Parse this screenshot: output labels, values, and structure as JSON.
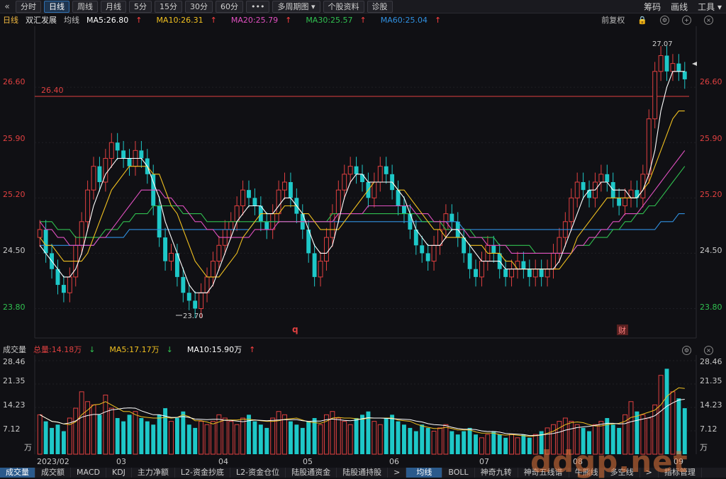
{
  "toolbar": {
    "back_icon": "chevron-left-icon",
    "tabs": [
      "分时",
      "日线",
      "周线",
      "月线",
      "5分",
      "15分",
      "30分",
      "60分",
      "•••",
      "多周期图",
      "个股资料",
      "诊股"
    ],
    "active_tab": "日线",
    "dropdown_label": "多周期图",
    "right_items": [
      "筹码",
      "画线",
      "工具"
    ]
  },
  "legend": {
    "period": "日线",
    "stock_name": "双汇发展",
    "ma_label": "均线",
    "ma5": "MA5:26.80",
    "ma10": "MA10:26.31",
    "ma20": "MA20:25.79",
    "ma30": "MA30:25.57",
    "ma60": "MA60:25.04",
    "adjust": "前复权",
    "colors": {
      "ma5": "#ffffff",
      "ma10": "#f0c020",
      "ma20": "#e050c0",
      "ma30": "#30c050",
      "ma60": "#3090e0"
    }
  },
  "price_axis": {
    "ticks": [
      "26.60",
      "25.90",
      "25.20",
      "24.50",
      "23.80"
    ],
    "ref_line": "26.40",
    "high_label": "27.07",
    "low_label": "23.70",
    "marker_q": "q",
    "marker_cai": "财"
  },
  "volume": {
    "title": "成交量",
    "total": "总量:14.18万",
    "ma5": "MA5:17.17万",
    "ma10": "MA10:15.90万",
    "ticks": [
      "28.46",
      "21.35",
      "14.23",
      "7.12",
      "万"
    ],
    "dates": [
      "2023/02",
      "03",
      "04",
      "05",
      "06",
      "07",
      "08",
      "09"
    ]
  },
  "bottom_tabs": [
    "成交量",
    "成交额",
    "MACD",
    "KDJ",
    "主力净额",
    "L2-资金抄底",
    "L2-资金仓位",
    "陆股通资金",
    "陆股通持股",
    "均线",
    "BOLL",
    "神奇九转",
    "神奇五线谱",
    "牛熊线",
    "多空线",
    "指标管理"
  ],
  "bottom_active": [
    "成交量",
    "均线"
  ],
  "watermark": "ddgp.net",
  "chart_data": {
    "type": "candlestick",
    "price_range": [
      23.5,
      27.3
    ],
    "volume_range": [
      0,
      28.46
    ],
    "volume_unit": "万",
    "closes": [
      24.8,
      24.5,
      24.3,
      24.1,
      24.0,
      24.2,
      24.6,
      24.9,
      25.3,
      25.6,
      25.4,
      25.7,
      25.9,
      25.8,
      25.7,
      25.6,
      25.8,
      25.7,
      25.5,
      25.1,
      24.7,
      24.4,
      24.5,
      24.2,
      24.0,
      23.9,
      23.8,
      24.0,
      24.2,
      24.4,
      24.6,
      24.8,
      24.9,
      25.1,
      25.3,
      25.2,
      25.1,
      24.9,
      24.8,
      25.0,
      25.3,
      25.4,
      25.2,
      25.0,
      24.8,
      24.5,
      24.2,
      24.4,
      24.7,
      25.0,
      25.3,
      25.5,
      25.6,
      25.5,
      25.4,
      25.2,
      25.4,
      25.6,
      25.5,
      25.3,
      25.1,
      25.0,
      24.8,
      24.6,
      24.5,
      24.4,
      24.6,
      24.8,
      25.0,
      24.9,
      24.7,
      24.5,
      24.3,
      24.2,
      24.4,
      24.6,
      24.5,
      24.3,
      24.2,
      24.3,
      24.4,
      24.3,
      24.2,
      24.3,
      24.2,
      24.3,
      24.5,
      24.7,
      24.9,
      25.2,
      25.4,
      25.3,
      25.2,
      25.4,
      25.5,
      25.4,
      25.2,
      25.1,
      25.2,
      25.3,
      25.2,
      25.5,
      26.2,
      26.8,
      27.0,
      26.8,
      26.9,
      26.8,
      26.7
    ],
    "volumes": [
      12,
      10,
      8,
      9,
      7,
      11,
      14,
      19,
      16,
      15,
      12,
      18,
      14,
      11,
      10,
      12,
      13,
      11,
      10,
      9,
      12,
      14,
      10,
      11,
      13,
      9,
      8,
      10,
      9,
      10,
      12,
      11,
      10,
      9,
      11,
      12,
      10,
      9,
      8,
      11,
      13,
      12,
      10,
      9,
      8,
      10,
      11,
      9,
      12,
      13,
      11,
      10,
      9,
      11,
      12,
      13,
      10,
      9,
      11,
      12,
      10,
      9,
      8,
      7,
      9,
      8,
      7,
      8,
      9,
      7,
      6,
      7,
      8,
      6,
      5,
      6,
      7,
      6,
      5,
      6,
      5,
      6,
      5,
      6,
      7,
      8,
      9,
      10,
      11,
      10,
      9,
      8,
      7,
      9,
      10,
      11,
      9,
      8,
      12,
      16,
      13,
      12,
      11,
      15,
      24,
      26,
      19,
      17,
      14
    ],
    "ma5": [
      24.6,
      24.5,
      24.4,
      24.3,
      24.2,
      24.2,
      24.3,
      24.5,
      24.8,
      25.1,
      25.3,
      25.5,
      25.6,
      25.7,
      25.7,
      25.7,
      25.7,
      25.7,
      25.6,
      25.4,
      25.2,
      24.9,
      24.7,
      24.5,
      24.3,
      24.1,
      24.0,
      24.0,
      24.0,
      24.1,
      24.3,
      24.5,
      24.7,
      24.9,
      25.0,
      25.1,
      25.1,
      25.1,
      25.0,
      25.0,
      25.1,
      25.2,
      25.2,
      25.1,
      25.0,
      24.8,
      24.6,
      24.5,
      24.5,
      24.6,
      24.9,
      25.2,
      25.4,
      25.5,
      25.5,
      25.4,
      25.4,
      25.4,
      25.4,
      25.4,
      25.3,
      25.2,
      25.0,
      24.8,
      24.7,
      24.6,
      24.6,
      24.6,
      24.7,
      24.8,
      24.8,
      24.7,
      24.6,
      24.5,
      24.4,
      24.4,
      24.4,
      24.4,
      24.3,
      24.3,
      24.3,
      24.3,
      24.3,
      24.3,
      24.3,
      24.3,
      24.3,
      24.4,
      24.6,
      24.8,
      25.0,
      25.2,
      25.3,
      25.3,
      25.4,
      25.4,
      25.3,
      25.3,
      25.3,
      25.2,
      25.2,
      25.3,
      25.5,
      25.8,
      26.3,
      26.6,
      26.8,
      26.8,
      26.8
    ],
    "ma10": [
      24.7,
      24.6,
      24.6,
      24.5,
      24.4,
      24.4,
      24.4,
      24.4,
      24.5,
      24.7,
      24.9,
      25.1,
      25.3,
      25.4,
      25.5,
      25.6,
      25.6,
      25.6,
      25.6,
      25.5,
      25.5,
      25.3,
      25.1,
      25.0,
      24.8,
      24.6,
      24.4,
      24.3,
      24.2,
      24.2,
      24.2,
      24.3,
      24.4,
      24.5,
      24.7,
      24.8,
      24.9,
      25.0,
      25.0,
      25.0,
      25.0,
      25.1,
      25.1,
      25.1,
      25.0,
      25.0,
      24.9,
      24.8,
      24.8,
      24.8,
      24.8,
      24.9,
      25.0,
      25.1,
      25.2,
      25.3,
      25.4,
      25.4,
      25.4,
      25.4,
      25.3,
      25.3,
      25.2,
      25.1,
      25.0,
      24.9,
      24.8,
      24.8,
      24.7,
      24.7,
      24.7,
      24.7,
      24.6,
      24.6,
      24.6,
      24.5,
      24.5,
      24.5,
      24.4,
      24.4,
      24.3,
      24.3,
      24.3,
      24.3,
      24.3,
      24.3,
      24.3,
      24.3,
      24.4,
      24.5,
      24.7,
      24.8,
      24.9,
      25.0,
      25.1,
      25.2,
      25.2,
      25.2,
      25.2,
      25.2,
      25.2,
      25.3,
      25.4,
      25.6,
      25.8,
      26.0,
      26.2,
      26.3,
      26.3
    ],
    "ma20": [
      24.9,
      24.8,
      24.8,
      24.7,
      24.7,
      24.6,
      24.6,
      24.6,
      24.6,
      24.6,
      24.7,
      24.7,
      24.8,
      24.9,
      25.0,
      25.1,
      25.2,
      25.3,
      25.3,
      25.3,
      25.3,
      25.2,
      25.2,
      25.1,
      25.1,
      25.0,
      24.9,
      24.9,
      24.8,
      24.8,
      24.7,
      24.7,
      24.7,
      24.7,
      24.7,
      24.7,
      24.8,
      24.8,
      24.8,
      24.8,
      24.9,
      24.9,
      24.9,
      24.9,
      24.9,
      24.9,
      24.9,
      24.9,
      24.9,
      24.9,
      25.0,
      25.0,
      25.0,
      25.0,
      25.0,
      25.1,
      25.1,
      25.1,
      25.1,
      25.1,
      25.1,
      25.1,
      25.1,
      25.0,
      25.0,
      25.0,
      24.9,
      24.9,
      24.9,
      24.8,
      24.8,
      24.8,
      24.7,
      24.7,
      24.7,
      24.6,
      24.6,
      24.6,
      24.6,
      24.5,
      24.5,
      24.5,
      24.5,
      24.5,
      24.5,
      24.5,
      24.5,
      24.5,
      24.5,
      24.5,
      24.6,
      24.6,
      24.7,
      24.7,
      24.8,
      24.8,
      24.9,
      24.9,
      25.0,
      25.0,
      25.0,
      25.1,
      25.2,
      25.3,
      25.4,
      25.5,
      25.6,
      25.7,
      25.8
    ],
    "ma30": [
      24.9,
      24.9,
      24.9,
      24.8,
      24.8,
      24.8,
      24.7,
      24.7,
      24.7,
      24.7,
      24.7,
      24.8,
      24.8,
      24.8,
      24.9,
      24.9,
      25.0,
      25.0,
      25.0,
      25.1,
      25.1,
      25.1,
      25.1,
      25.1,
      25.0,
      25.0,
      25.0,
      25.0,
      24.9,
      24.9,
      24.9,
      24.9,
      24.9,
      24.9,
      24.9,
      24.9,
      24.9,
      24.9,
      24.9,
      24.9,
      24.9,
      24.9,
      24.9,
      24.9,
      24.9,
      24.9,
      24.9,
      24.9,
      24.9,
      25.0,
      25.0,
      25.0,
      25.0,
      25.0,
      25.0,
      25.0,
      25.0,
      25.0,
      25.0,
      25.0,
      25.0,
      25.0,
      25.0,
      25.0,
      24.9,
      24.9,
      24.9,
      24.9,
      24.8,
      24.8,
      24.8,
      24.8,
      24.8,
      24.7,
      24.7,
      24.7,
      24.7,
      24.6,
      24.6,
      24.6,
      24.6,
      24.6,
      24.6,
      24.5,
      24.5,
      24.5,
      24.5,
      24.5,
      24.5,
      24.5,
      24.6,
      24.6,
      24.6,
      24.7,
      24.7,
      24.7,
      24.8,
      24.8,
      24.9,
      24.9,
      25.0,
      25.0,
      25.1,
      25.1,
      25.2,
      25.3,
      25.4,
      25.5,
      25.6
    ],
    "ma60": [
      24.6,
      24.6,
      24.6,
      24.6,
      24.6,
      24.6,
      24.6,
      24.6,
      24.6,
      24.6,
      24.7,
      24.7,
      24.7,
      24.7,
      24.7,
      24.8,
      24.8,
      24.8,
      24.8,
      24.8,
      24.8,
      24.8,
      24.8,
      24.8,
      24.8,
      24.8,
      24.8,
      24.8,
      24.8,
      24.8,
      24.8,
      24.8,
      24.8,
      24.8,
      24.8,
      24.8,
      24.9,
      24.9,
      24.9,
      24.9,
      24.9,
      24.9,
      24.9,
      24.9,
      24.9,
      24.9,
      24.9,
      24.9,
      24.9,
      24.9,
      24.9,
      24.9,
      24.9,
      24.9,
      24.9,
      24.9,
      24.9,
      24.9,
      24.9,
      24.9,
      24.9,
      24.9,
      24.9,
      24.9,
      24.9,
      24.9,
      24.9,
      24.9,
      24.9,
      24.9,
      24.9,
      24.8,
      24.8,
      24.8,
      24.8,
      24.8,
      24.8,
      24.8,
      24.8,
      24.8,
      24.8,
      24.8,
      24.8,
      24.8,
      24.8,
      24.8,
      24.8,
      24.8,
      24.8,
      24.8,
      24.8,
      24.8,
      24.8,
      24.8,
      24.8,
      24.8,
      24.8,
      24.8,
      24.8,
      24.8,
      24.8,
      24.8,
      24.8,
      24.8,
      24.9,
      24.9,
      24.9,
      25.0,
      25.0
    ]
  }
}
